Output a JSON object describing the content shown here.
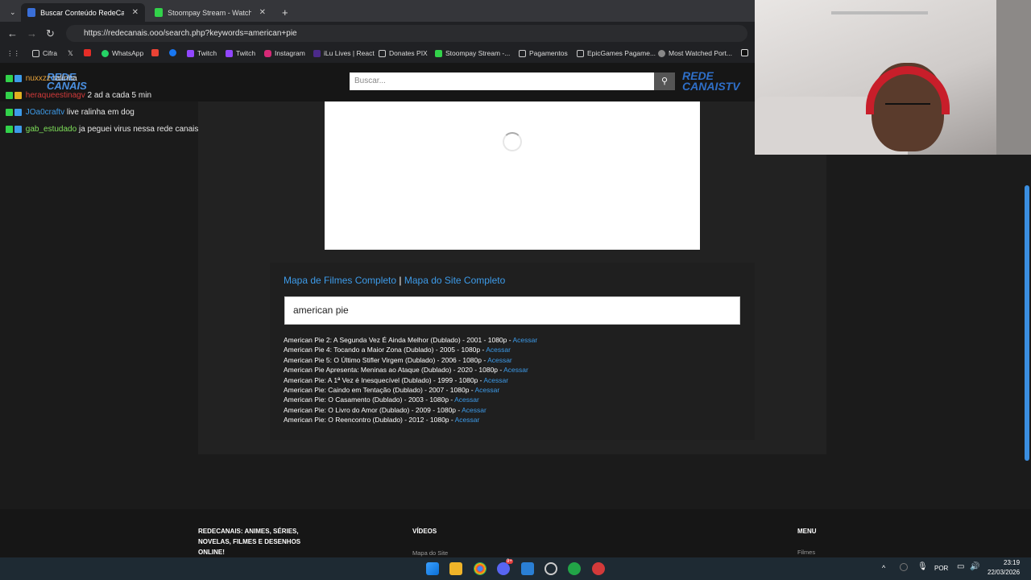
{
  "browser": {
    "tabs": [
      {
        "title": "Buscar Conteúdo RedeCanais: a",
        "active": true
      },
      {
        "title": "Stoompay Stream - Watch Live",
        "active": false
      }
    ],
    "url": "https://redecanais.ooo/search.php?keywords=american+pie",
    "bookmarks": [
      "Cifra",
      "WhatsApp",
      "Twitch",
      "Twitch",
      "Instagram",
      "iLu Lives | React",
      "Donates PIX",
      "Stoompay Stream -...",
      "Pagamentos",
      "EpicGames Pagame...",
      "Most Watched Port..."
    ]
  },
  "site": {
    "logo_left": "REDE CANAIS",
    "search_placeholder": "Buscar...",
    "logo_right": "REDE CANAISTV",
    "map_links": {
      "films": "Mapa de Filmes Completo",
      "separator": "|",
      "site": "Mapa do Site Completo"
    },
    "keyword": "american pie",
    "results": [
      {
        "title": "American Pie 2: A Segunda Vez É Ainda Melhor (Dublado) - 2001 - 1080p - ",
        "link": "Acessar"
      },
      {
        "title": "American Pie 4: Tocando a Maior Zona (Dublado) - 2005 - 1080p - ",
        "link": "Acessar"
      },
      {
        "title": "American Pie 5: O Último Stifler Virgem (Dublado) - 2006 - 1080p - ",
        "link": "Acessar"
      },
      {
        "title": "American Pie Apresenta: Meninas ao Ataque (Dublado) - 2020 - 1080p - ",
        "link": "Acessar"
      },
      {
        "title": "American Pie: A 1ª Vez é Inesquecível (Dublado) - 1999 - 1080p - ",
        "link": "Acessar"
      },
      {
        "title": "American Pie: Caindo em Tentação (Dublado) - 2007 - 1080p - ",
        "link": "Acessar"
      },
      {
        "title": "American Pie: O Casamento (Dublado) - 2003 - 1080p - ",
        "link": "Acessar"
      },
      {
        "title": "American Pie: O Livro do Amor (Dublado) - 2009 - 1080p - ",
        "link": "Acessar"
      },
      {
        "title": "American Pie: O Reencontro (Dublado) - 2012 - 1080p - ",
        "link": "Acessar"
      }
    ],
    "footer": {
      "about": "REDECANAIS: ANIMES, SÉRIES, NOVELAS, FILMES E DESENHOS ONLINE!",
      "videos_title": "VÍDEOS",
      "videos_sub": "Mapa do Site",
      "menu_title": "MENU",
      "menu_sub": "Filmes"
    }
  },
  "chat": [
    {
      "user": "nuxxzz",
      "message": "ralinha",
      "user_color": "#e8a33a"
    },
    {
      "user": "heraqueestinagv",
      "message": "2 ad a cada 5 min",
      "user_color": "#d13a3a"
    },
    {
      "user": "JOa0craftv",
      "message": "live ralinha em dog",
      "user_color": "#3d9be9"
    },
    {
      "user": "gab_estudado",
      "message": "ja peguei virus nessa rede canais",
      "user_color": "#7fe05a"
    }
  ],
  "taskbar": {
    "language": "POR",
    "time": "23:19",
    "date": "22/03/2026",
    "discord_badge": "9+"
  },
  "colors": {
    "accent": "#3d9be9",
    "page_bg": "#1b1b1b"
  }
}
